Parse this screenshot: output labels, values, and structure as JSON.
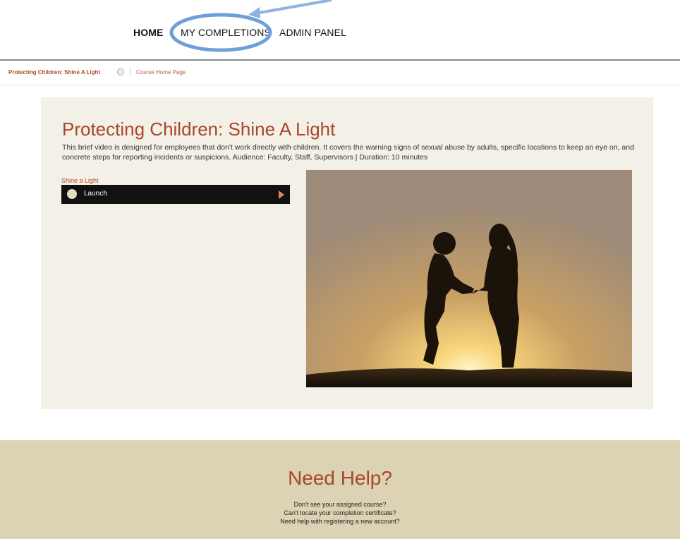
{
  "nav": {
    "home": "HOME",
    "completions": "MY COMPLETIONS",
    "admin": "ADMIN PANEL"
  },
  "breadcrumb": {
    "course": "Protecting Children: Shine A Light",
    "page": "Course Home Page"
  },
  "course": {
    "title": "Protecting Children: Shine A Light",
    "description": "This brief video is designed for employees that don't work directly with children. It covers the warning signs of sexual abuse by adults, specific locations to keep an eye on, and concrete steps for reporting incidents or suspicions. Audience: Faculty, Staff, Supervisors | Duration: 10 minutes",
    "module_label": "Shine a Light",
    "launch_label": "Launch"
  },
  "help": {
    "title": "Need Help?",
    "lines": [
      "Don't see your assigned course?",
      "Can't locate your completion certificate?",
      "Need help with registering a new account?"
    ]
  },
  "colors": {
    "accent": "#a9472b",
    "panel_bg": "#f3f0e7",
    "help_bg": "#dbd3b3",
    "annotation": "#6f9fd8"
  }
}
